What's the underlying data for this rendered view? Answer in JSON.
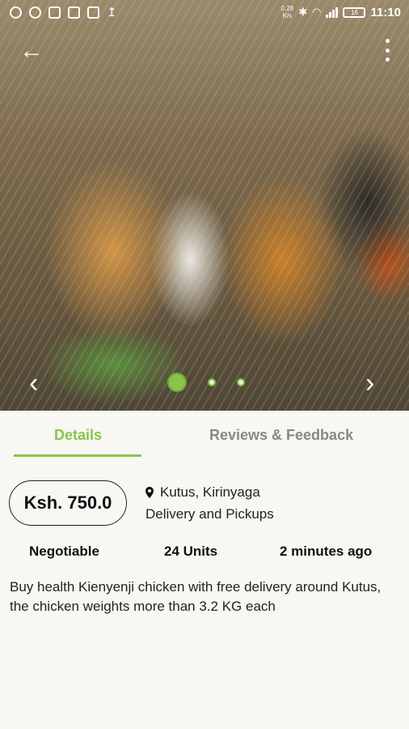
{
  "status_bar": {
    "net_speed": "0.28",
    "net_unit": "K/s",
    "battery": "16",
    "time": "11:10",
    "icons": [
      "chrome-icon",
      "messenger-icon",
      "briefcase-icon",
      "image-icon",
      "copy-icon",
      "upload-icon",
      "bluetooth-icon",
      "wifi-icon",
      "signal-icon"
    ]
  },
  "gallery": {
    "image_count": 3,
    "active_index": 0,
    "back_icon": "back-arrow-icon",
    "menu_icon": "more-vert-icon"
  },
  "tabs": [
    {
      "label": "Details",
      "active": true
    },
    {
      "label": "Reviews & Feedback",
      "active": false
    }
  ],
  "listing": {
    "price": "Ksh. 750.0",
    "location": "Kutus, Kirinyaga",
    "delivery": "Delivery and Pickups",
    "negotiable": "Negotiable",
    "units": "24 Units",
    "posted": "2 minutes ago",
    "description": "Buy health Kienyenji chicken with free delivery around Kutus, the chicken weights more than 3.2 KG each"
  },
  "colors": {
    "accent": "#8bc34a",
    "inactive_tab": "#888888",
    "background": "#f8f7f3"
  }
}
